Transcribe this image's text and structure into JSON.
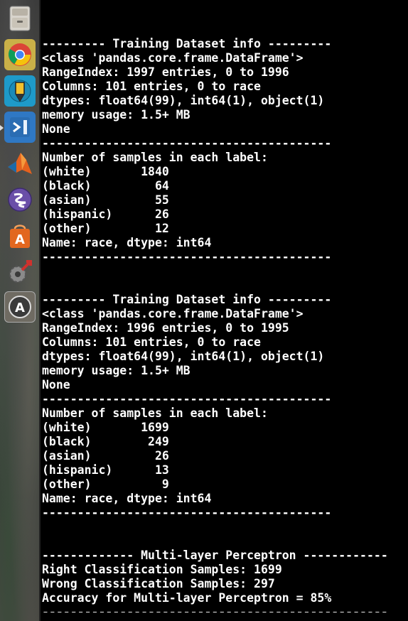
{
  "launcher": {
    "items": [
      {
        "name": "files-icon"
      },
      {
        "name": "chrome-icon"
      },
      {
        "name": "pencil-app-icon"
      },
      {
        "name": "vscode-icon"
      },
      {
        "name": "matlab-icon"
      },
      {
        "name": "emacs-icon"
      },
      {
        "name": "software-center-icon"
      },
      {
        "name": "system-settings-icon"
      },
      {
        "name": "software-updater-icon"
      }
    ]
  },
  "terminal": {
    "lines": [
      "",
      "--------- Training Dataset info ---------",
      "<class 'pandas.core.frame.DataFrame'>",
      "RangeIndex: 1997 entries, 0 to 1996",
      "Columns: 101 entries, 0 to race",
      "dtypes: float64(99), int64(1), object(1)",
      "memory usage: 1.5+ MB",
      "None",
      "-----------------------------------------",
      "Number of samples in each label:",
      "(white)       1840",
      "(black)         64",
      "(asian)         55",
      "(hispanic)      26",
      "(other)         12",
      "Name: race, dtype: int64",
      "-----------------------------------------",
      "",
      "",
      "--------- Training Dataset info ---------",
      "<class 'pandas.core.frame.DataFrame'>",
      "RangeIndex: 1996 entries, 0 to 1995",
      "Columns: 101 entries, 0 to race",
      "dtypes: float64(99), int64(1), object(1)",
      "memory usage: 1.5+ MB",
      "None",
      "-----------------------------------------",
      "Number of samples in each label:",
      "(white)       1699",
      "(black)        249",
      "(asian)         26",
      "(hispanic)      13",
      "(other)          9",
      "Name: race, dtype: int64",
      "-----------------------------------------",
      "",
      "",
      "------------- Multi-layer Perceptron ------------",
      "Right Classification Samples: 1699",
      "Wrong Classification Samples: 297",
      "Accuracy for Multi-layer Perceptron = 85%",
      "-------------------------------------------------"
    ]
  }
}
